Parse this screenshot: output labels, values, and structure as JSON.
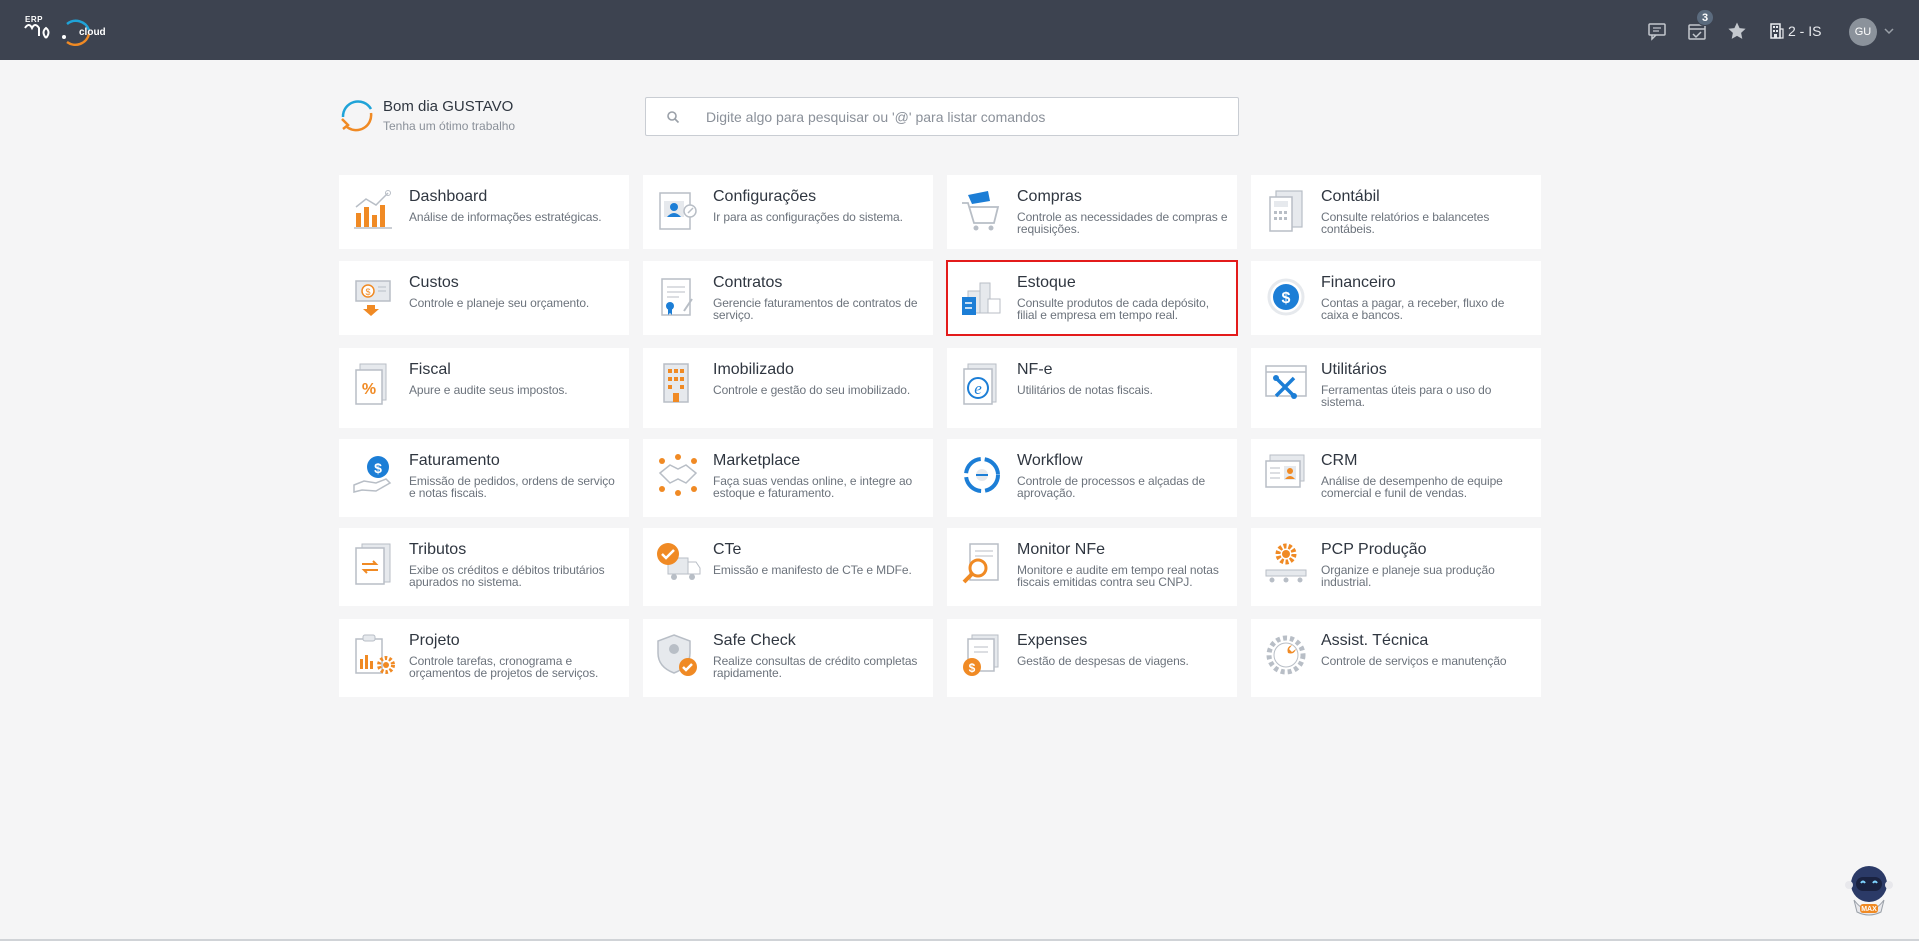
{
  "header": {
    "logo": {
      "brand": "ERP",
      "suffix": "cloud"
    },
    "notifications_badge": "3",
    "company": "2 - IS",
    "user_initials": "GU"
  },
  "greeting": {
    "title": "Bom dia GUSTAVO",
    "subtitle": "Tenha um ótimo trabalho"
  },
  "search": {
    "placeholder": "Digite algo para pesquisar ou '@' para listar comandos",
    "value": ""
  },
  "modules": [
    {
      "title": "Dashboard",
      "desc": "Análise de informações estratégicas.",
      "icon": "dashboard-chart-icon"
    },
    {
      "title": "Configurações",
      "desc": "Ir para as configurações do sistema.",
      "icon": "settings-profile-icon"
    },
    {
      "title": "Compras",
      "desc": "Controle as necessidades de compras e requisições.",
      "icon": "shopping-cart-icon"
    },
    {
      "title": "Contábil",
      "desc": "Consulte relatórios e balancetes contábeis.",
      "icon": "accounting-calculator-icon"
    },
    {
      "title": "Custos",
      "desc": "Controle e planeje seu orçamento.",
      "icon": "costs-money-icon"
    },
    {
      "title": "Contratos",
      "desc": "Gerencie faturamentos de contratos de serviço.",
      "icon": "contract-document-icon"
    },
    {
      "title": "Estoque",
      "desc": "Consulte produtos de cada depósito, filial e empresa em tempo real.",
      "icon": "warehouse-stock-icon"
    },
    {
      "title": "Financeiro",
      "desc": "Contas a pagar, a receber, fluxo de caixa e bancos.",
      "icon": "finance-dollar-icon"
    },
    {
      "title": "Fiscal",
      "desc": "Apure e audite seus impostos.",
      "icon": "fiscal-percent-icon"
    },
    {
      "title": "Imobilizado",
      "desc": "Controle e gestão do seu imobilizado.",
      "icon": "building-assets-icon"
    },
    {
      "title": "NF-e",
      "desc": "Utilitários de notas fiscais.",
      "icon": "nfe-document-icon"
    },
    {
      "title": "Utilitários",
      "desc": "Ferramentas úteis para o uso do sistema.",
      "icon": "tools-utilities-icon"
    },
    {
      "title": "Faturamento",
      "desc": "Emissão de pedidos, ordens de serviço e notas fiscais.",
      "icon": "billing-hand-dollar-icon"
    },
    {
      "title": "Marketplace",
      "desc": "Faça suas vendas online, e integre ao estoque e faturamento.",
      "icon": "marketplace-handshake-icon"
    },
    {
      "title": "Workflow",
      "desc": "Controle de processos e alçadas de aprovação.",
      "icon": "workflow-cycle-icon"
    },
    {
      "title": "CRM",
      "desc": "Análise de desempenho de equipe comercial e funil de vendas.",
      "icon": "crm-contact-card-icon"
    },
    {
      "title": "Tributos",
      "desc": "Exibe os créditos e débitos tributários apurados no sistema.",
      "icon": "taxes-exchange-icon"
    },
    {
      "title": "CTe",
      "desc": "Emissão e manifesto de CTe e MDFe.",
      "icon": "cte-truck-check-icon"
    },
    {
      "title": "Monitor NFe",
      "desc": "Monitore e audite em tempo real notas fiscais emitidas contra seu CNPJ.",
      "icon": "monitor-magnifier-icon"
    },
    {
      "title": "PCP Produção",
      "desc": "Organize e planeje sua produção industrial.",
      "icon": "production-gear-icon"
    },
    {
      "title": "Projeto",
      "desc": "Controle tarefas, cronograma e orçamentos de projetos de serviços.",
      "icon": "project-clipboard-gear-icon"
    },
    {
      "title": "Safe Check",
      "desc": "Realize consultas de crédito completas rapidamente.",
      "icon": "safe-check-shield-icon"
    },
    {
      "title": "Expenses",
      "desc": "Gestão de despesas de viagens.",
      "icon": "expenses-receipt-icon"
    },
    {
      "title": "Assist. Técnica",
      "desc": "Controle de serviços e manutenção",
      "icon": "tech-support-wrench-icon"
    }
  ],
  "selected_module": "Estoque",
  "assistant": {
    "label": "MAX"
  },
  "colors": {
    "topbar": "#3d4350",
    "accent_orange": "#f08a24",
    "accent_blue": "#1c7ed6",
    "selected_outline": "#e31b1b"
  }
}
